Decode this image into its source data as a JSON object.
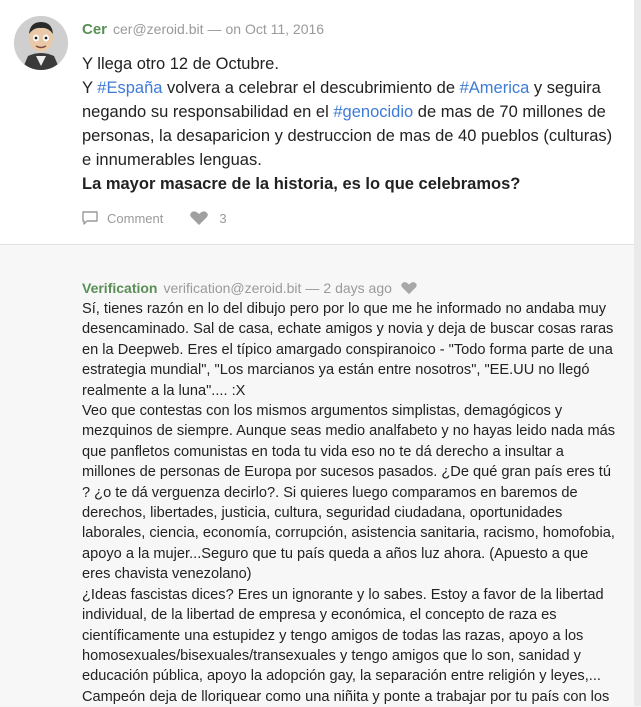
{
  "post": {
    "author": "Cer",
    "handle": "cer@zeroid.bit",
    "separator": "—",
    "date": "on Oct 11, 2016",
    "body": {
      "line1": "Y llega otro 12 de Octubre.",
      "p2_start": "Y ",
      "tag_spain": "#España",
      "p2_mid1": " volvera a celebrar el descubrimiento de ",
      "tag_america": "#America",
      "p2_mid2": " y seguira negando su responsabilidad en el ",
      "tag_genocide": "#genocidio",
      "p2_end": " de mas de 70 millones de personas, la desaparicion y destruccion de mas de 40 pueblos (culturas) e innumerables lenguas.",
      "bold_line": "La mayor masacre de la historia, es lo que celebramos?"
    },
    "actions": {
      "comment_label": "Comment",
      "like_count": "3"
    }
  },
  "reply": {
    "author": "Verification",
    "handle": "verification@zeroid.bit",
    "separator": "—",
    "date": "2 days ago",
    "paragraphs": [
      "Sí, tienes razón en lo del dibujo pero por lo que me he informado no andaba muy desencaminado. Sal de casa, echate amigos y novia y deja de buscar cosas raras en la Deepweb. Eres el típico amargado conspiranoico - \"Todo forma parte de una estrategia mundial\", \"Los marcianos ya están entre nosotros\", \"EE.UU no llegó realmente a la luna\".... :X",
      "Veo que contestas con los mismos argumentos simplistas, demagógicos y mezquinos de siempre. Aunque seas medio analfabeto y no hayas leido nada más que panfletos comunistas en toda tu vida eso no te dá derecho a insultar a millones de personas de Europa por sucesos pasados. ¿De qué gran país eres tú ? ¿o te dá verguenza decirlo?. Si quieres luego comparamos en baremos de derechos, libertades, justicia, cultura, seguridad ciudadana, oportunidades laborales, ciencia, economía, corrupción, asistencia sanitaria, racismo, homofobia, apoyo a la mujer...Seguro que tu país queda a años luz ahora. (Apuesto a que eres chavista venezolano)",
      "¿Ideas fascistas dices? Eres un ignorante y lo sabes. Estoy a favor de la libertad individual, de la libertad de empresa y económica, el concepto de raza es científicamente una estupidez y tengo amigos de todas las razas, apoyo a los homosexuales/bisexuales/transexuales y tengo amigos que lo son, sanidad y educación pública, apoyo la adopción gay, la separación entre religión y leyes,... Campeón deja de lloriquear como una niñita y ponte a trabajar por tu país con los"
    ]
  },
  "colors": {
    "author_green": "#5a8f56",
    "tag_blue": "#3d7bd6",
    "meta_gray": "#9a9a9a"
  },
  "icons": {
    "avatar": "caricature-avatar",
    "comment": "comment-icon",
    "like": "heart-icon"
  }
}
